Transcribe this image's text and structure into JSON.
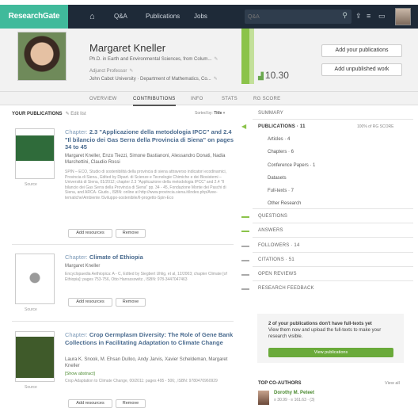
{
  "nav": {
    "logo": "ResearchGate",
    "items": [
      "Q&A",
      "Publications",
      "Jobs"
    ],
    "search_placeholder": "Q&A"
  },
  "profile": {
    "name": "Margaret Kneller",
    "degree": "Ph.D. in Earth and Environmental Sciences, from Colum...",
    "role": "Adjunct Professor",
    "institution": "John Cabot University · Department of Mathematics, Co...",
    "rg_score": "10.30",
    "add_publications": "Add your publications",
    "add_unpublished": "Add unpublished work"
  },
  "tabs": [
    "OVERVIEW",
    "CONTRIBUTIONS",
    "INFO",
    "STATS",
    "RG SCORE"
  ],
  "publications_header": {
    "title": "YOUR PUBLICATIONS",
    "edit": "Edit list",
    "sorted_label": "Sorted by:",
    "sorted_value": "Title"
  },
  "publications": [
    {
      "type": "Chapter:",
      "title": "2.3 \"Applicazione della metodologia IPCC\" and 2.4 \"Il bilancio dei Gas Serra della Provincia di Siena\" on pages 34 to 45",
      "authors": "Margaret Kneller, Enzo Tiezzi, Simone Bastianoni, Alessandro Donati, Nadia Marchettini, Claudio Rossi",
      "desc": "SPIN – ECO, Studio di sostenibilità della provincia di siena attraverso indicatori ecodinamici, Provincia di Siena., Edited by Dipart. di Scienze e Tecnologie Chimiche e dei Biosistemi – Università di Siena, 01/2012; chapter 2.3 \"Applicazione della metodologia IPCC\" and 2.4 \"Il bilancio dei Gas Serra della Provincia di Siena\" pp. 34 - 45, Fondazione Monte dei Paschi di Siena, and ARCA- Giudo., ISBN: online at http://www.provincia.siena.it/index.php/Aree-tematiche/Ambiente /Sviluppo-sostenibile/Il-progetto-Spin-Eco",
      "source": "Source",
      "add": "Add resources",
      "remove": "Remove"
    },
    {
      "type": "Chapter:",
      "title": "Climate of Ethiopia",
      "authors": "Margaret Kneller",
      "desc": "Encyclopaedia Aethiopica: A - C, Edited by Siegbert Uhlig, et al, 12/2003; chapter Climate [of Ethiopia]: pages 753-756, Otto Harrassowitz., ISBN: 978-3447047463",
      "source": "Source",
      "add": "Add resources",
      "remove": "Remove"
    },
    {
      "type": "Chapter:",
      "title": "Crop Germplasm Diversity: The Role of Gene Bank Collections in Facilitating Adaptation to Climate Change",
      "authors": "Laura K. Snook, M. Ehsan Dulloo, Andy Jarvis, Xavier Scheldeman, Margaret Kneller",
      "abstract": "[Show abstract]",
      "desc": "Crop Adaptation to Climate Change, 00/2011: pages 495 - 506;, ISBN: 9780470960929",
      "source": "Source",
      "add": "Add resources",
      "remove": "Remove"
    }
  ],
  "sidebar": {
    "summary": "SUMMARY",
    "publications": "PUBLICATIONS · 11",
    "publications_pct": "100% of RG SCORE",
    "sub": [
      "Articles · 4",
      "Chapters · 6",
      "Conference Papers · 1",
      "Datasets",
      "Full-texts · 7",
      "Other Research"
    ],
    "questions": "QUESTIONS",
    "answers": "ANSWERS",
    "followers": "FOLLOWERS · 14",
    "citations": "CITATIONS · 51",
    "open_reviews": "OPEN REVIEWS",
    "feedback": "RESEARCH FEEDBACK"
  },
  "promo": {
    "count": "2",
    "text": " of your publications don't have full-texts yet",
    "text2": "View them now and upload the full-texts to make your research visible.",
    "button": "View publications"
  },
  "coauthors": {
    "title": "TOP CO-AUTHORS",
    "view_all": "View all",
    "name": "Dorothy M. Peteet",
    "meta": "≡ 30.99 · ≡ 161.63 · (3)"
  },
  "colors": {
    "nav_bg": "#1e2a38",
    "brand": "#40ba9b",
    "accent_green": "#8bc34a",
    "link_blue": "#4a6b8f"
  }
}
